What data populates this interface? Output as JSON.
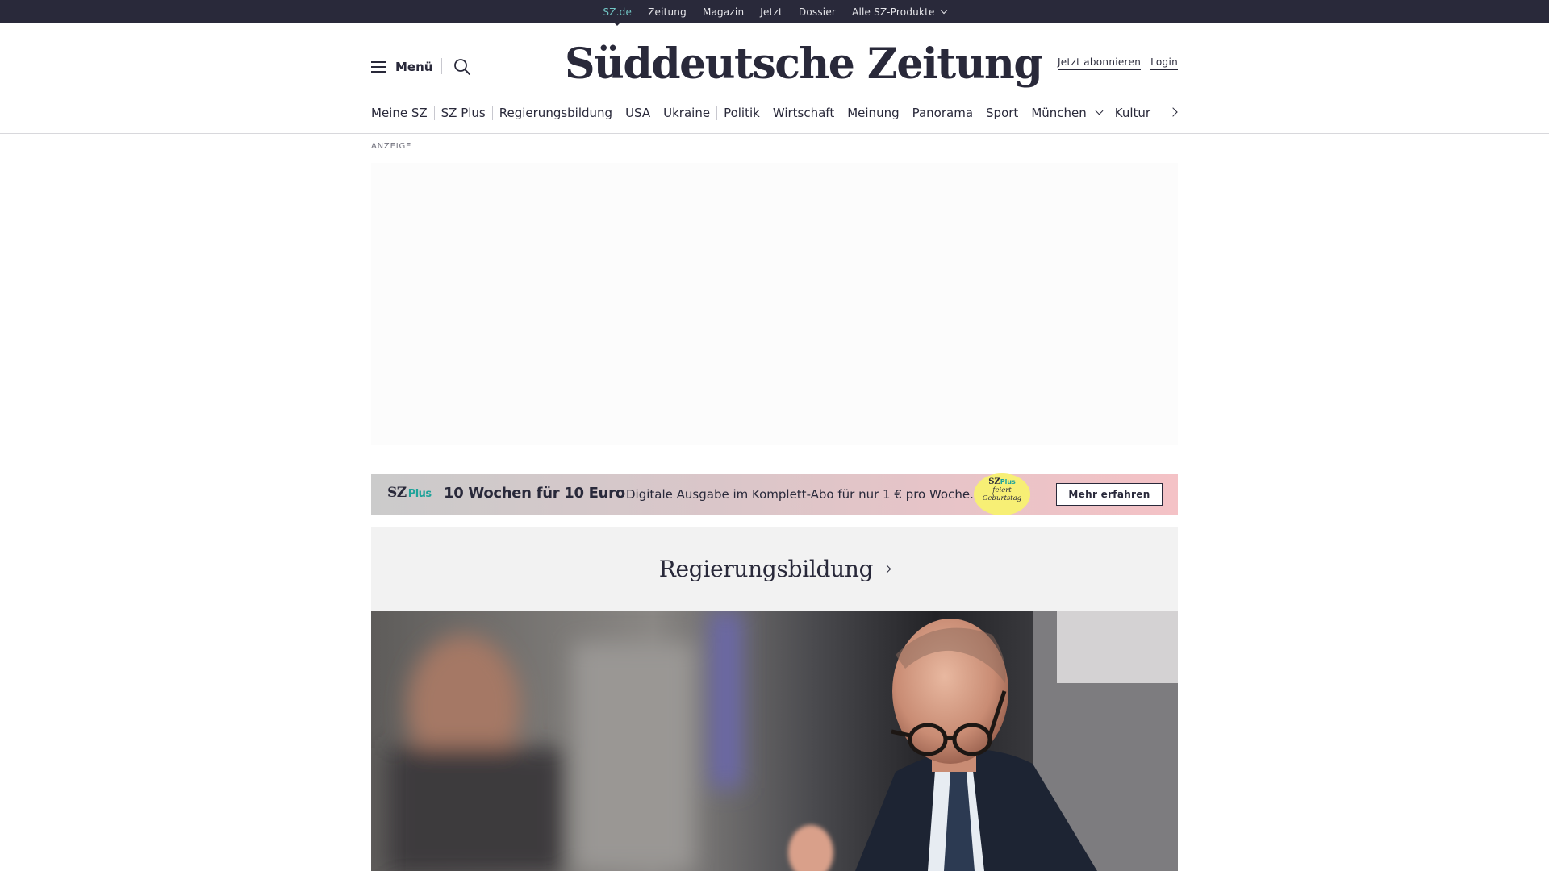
{
  "topbar": {
    "items": [
      {
        "label": "SZ.de",
        "active": true
      },
      {
        "label": "Zeitung"
      },
      {
        "label": "Magazin"
      },
      {
        "label": "Jetzt"
      },
      {
        "label": "Dossier"
      },
      {
        "label": "Alle SZ-Produkte",
        "has_dropdown": true
      }
    ]
  },
  "header": {
    "menu_label": "Menü",
    "search_icon": "search-icon",
    "logo_text": "Süddeutsche Zeitung",
    "subscribe_label": "Jetzt abonnieren",
    "login_label": "Login"
  },
  "ressort_nav": {
    "items": [
      {
        "label": "Meine SZ"
      },
      {
        "label": "SZ Plus"
      },
      {
        "label": "Regierungsbildung"
      },
      {
        "label": "USA"
      },
      {
        "label": "Ukraine"
      },
      {
        "label": "Politik"
      },
      {
        "label": "Wirtschaft"
      },
      {
        "label": "Meinung"
      },
      {
        "label": "Panorama"
      },
      {
        "label": "Sport"
      },
      {
        "label": "München",
        "has_dropdown": true
      },
      {
        "label": "Kultur"
      }
    ],
    "next_icon": "chevron-right-icon"
  },
  "ad": {
    "label": "ANZEIGE"
  },
  "promo": {
    "logo_sz": "SZ",
    "logo_plus": "Plus",
    "headline": "10 Wochen für 10 Euro",
    "subline": "Digitale Ausgabe im Komplett-Abo für nur 1 € pro Woche.",
    "badge_sz": "SZ",
    "badge_plus": "Plus",
    "badge_line1": "feiert",
    "badge_line2": "Geburtstag",
    "cta_label": "Mehr erfahren"
  },
  "section": {
    "title": "Regierungsbildung"
  },
  "colors": {
    "topbar_bg": "#29293a",
    "active_link": "#71c5c4",
    "sz_plus_teal": "#1fa39a",
    "badge_yellow": "#f7ef75",
    "promo_pink": "#f4c2c6",
    "section_bg": "#f2f2f2"
  }
}
